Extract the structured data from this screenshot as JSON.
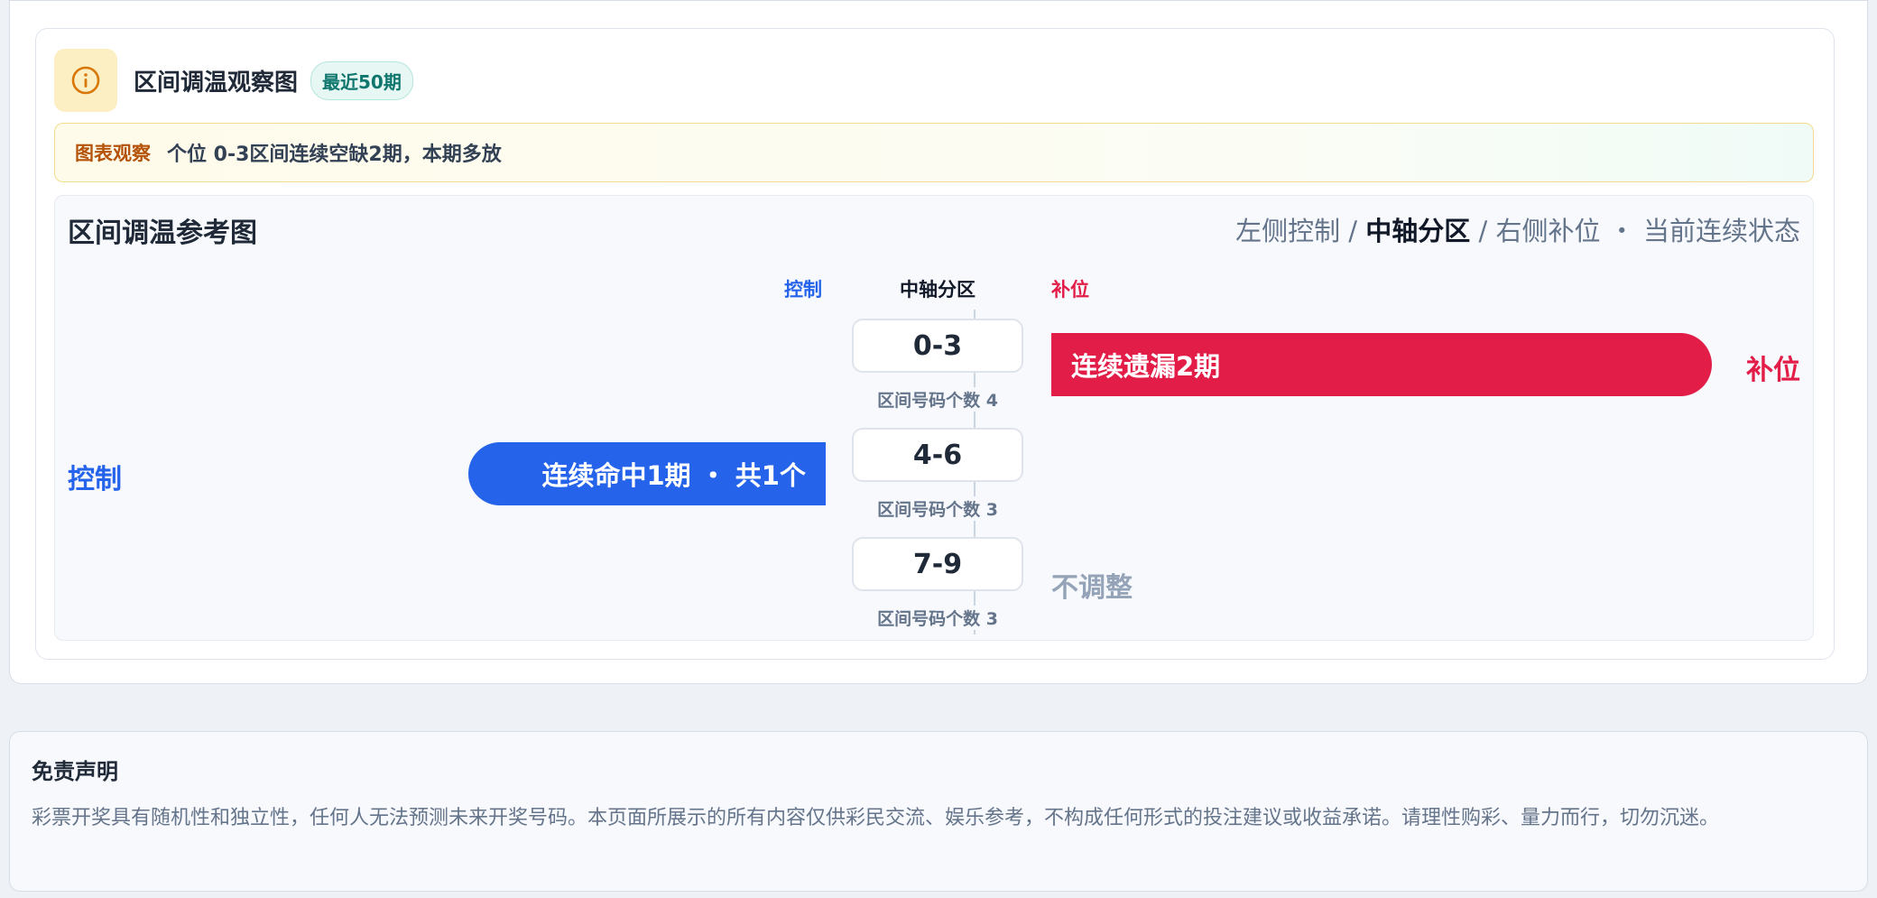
{
  "header": {
    "icon": "info-icon",
    "title": "区间调温观察图",
    "badge": "最近50期"
  },
  "observation": {
    "tag": "图表观察",
    "text": "个位 0-3区间连续空缺2期，本期多放"
  },
  "chart": {
    "title": "区间调温参考图",
    "legend": {
      "left": "左侧控制",
      "sep1": " / ",
      "center": "中轴分区",
      "sep2": " / ",
      "right": "右侧补位",
      "dot": " ・ ",
      "state": "当前连续状态"
    },
    "column_heads": {
      "left": "控制",
      "center": "中轴分区",
      "right": "补位"
    }
  },
  "chart_data": {
    "type": "bar",
    "categories": [
      "0-3",
      "4-6",
      "7-9"
    ],
    "bin_counts": [
      "区间号码个数 4",
      "区间号码个数 3",
      "区间号码个数 3"
    ],
    "rows": [
      {
        "bin": "0-3",
        "side": "补位",
        "label": "连续遗漏2期",
        "streak": 2,
        "side_label": "补位"
      },
      {
        "bin": "4-6",
        "side": "控制",
        "label": "连续命中1期 ・ 共1个",
        "streak": 1,
        "side_label": "控制"
      },
      {
        "bin": "7-9",
        "side": "none",
        "label": "不调整",
        "streak": 0
      }
    ],
    "colors": {
      "control": "#2563eb",
      "fill": "#e11d48",
      "neutral": "#94a3b8"
    }
  },
  "disclaimer": {
    "title": "免责声明",
    "text": "彩票开奖具有随机性和独立性，任何人无法预测未来开奖号码。本页面所展示的所有内容仅供彩民交流、娱乐参考，不构成任何形式的投注建议或收益承诺。请理性购彩、量力而行，切勿沉迷。"
  }
}
